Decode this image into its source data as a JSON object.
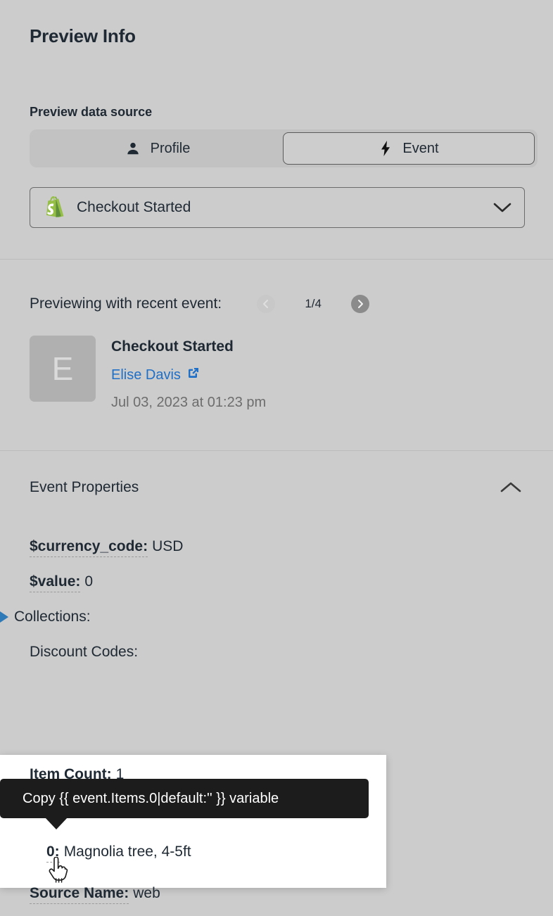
{
  "header": {
    "title": "Preview Info"
  },
  "data_source": {
    "label": "Preview data source",
    "segments": [
      {
        "label": "Profile",
        "icon": "person-icon",
        "selected": false
      },
      {
        "label": "Event",
        "icon": "lightning-bolt-icon",
        "selected": true
      }
    ],
    "dropdown": {
      "icon": "shopify-icon",
      "value": "Checkout Started",
      "chevron": "chevron-down-icon"
    }
  },
  "preview": {
    "heading": "Previewing with recent event:",
    "pager": {
      "prev_icon": "chevron-left-circle-icon",
      "next_icon": "chevron-right-circle-icon",
      "count": "1/4",
      "prev_disabled": true,
      "next_disabled": false
    },
    "event": {
      "avatar_initial": "E",
      "name": "Checkout Started",
      "person": "Elise Davis",
      "person_link_icon": "external-link-icon",
      "timestamp": "Jul 03, 2023 at 01:23 pm"
    }
  },
  "event_properties": {
    "title": "Event Properties",
    "toggle_icon": "chevron-up-icon",
    "rows": [
      {
        "key": "$currency_code:",
        "value": "USD"
      },
      {
        "key": "$value:",
        "value": "0"
      },
      {
        "key": "Collections:",
        "value": "",
        "expander": "triangle-right-icon"
      },
      {
        "key": "Discount Codes:",
        "value": ""
      },
      {
        "key": "Item Count:",
        "value": "1"
      },
      {
        "key": "0:",
        "value": "Magnolia tree, 4-5ft"
      },
      {
        "key": "Source Name:",
        "value": "web"
      }
    ]
  },
  "tooltip": {
    "text": "Copy {{ event.Items.0|default:'' }} variable"
  },
  "colors": {
    "background": "#cccccc",
    "panel_white": "#ffffff",
    "tooltip_bg": "#1c1c1c",
    "link_blue": "#1f6fc7",
    "expander_blue": "#2e7ab8",
    "avatar_gray": "#b0b0b0",
    "shopify_green": "#7db249",
    "divider": "#bcbcbc"
  }
}
